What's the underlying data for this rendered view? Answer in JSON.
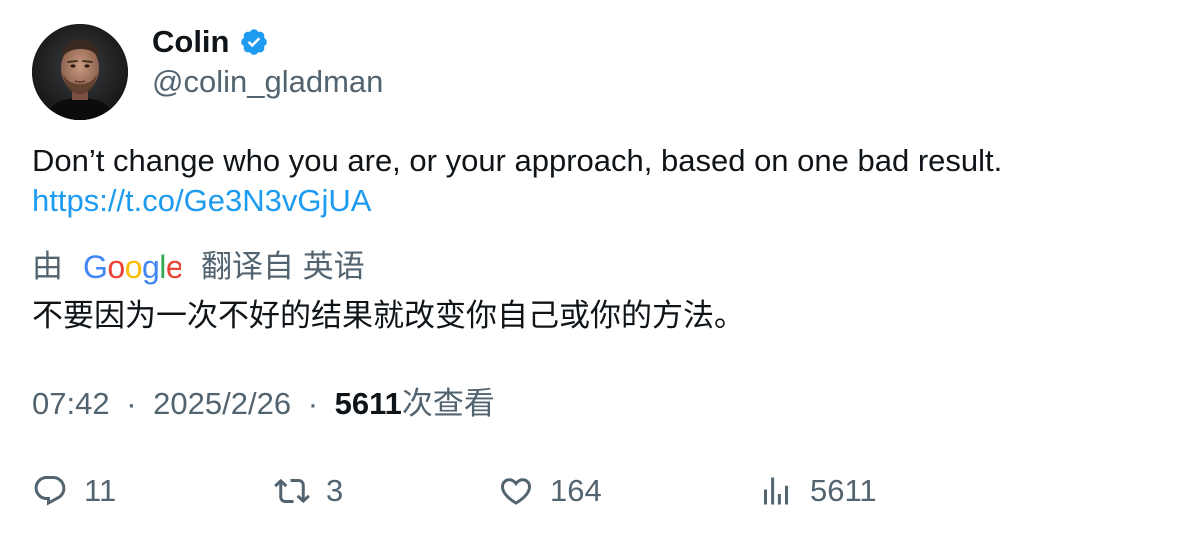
{
  "author": {
    "display_name": "Colin",
    "handle": "@colin_gladman",
    "verified": true,
    "verified_color": "#1d9bf0"
  },
  "tweet": {
    "text": "Don’t change who you are, or your approach, based on one bad result.",
    "link": "https://t.co/Ge3N3vGjUA"
  },
  "translation": {
    "prefix": "由",
    "provider": "Google",
    "suffix": "翻译自 英语",
    "text": "不要因为一次不好的结果就改变你自己或你的方法。"
  },
  "meta": {
    "time": "07:42",
    "date": "2025/2/26",
    "separator": "·",
    "views_count": "5611",
    "views_label": "次查看"
  },
  "actions": {
    "replies": "11",
    "retweets": "3",
    "likes": "164",
    "views": "5611"
  },
  "colors": {
    "text_primary": "#0f1419",
    "text_secondary": "#536471",
    "link": "#1d9bf0"
  }
}
